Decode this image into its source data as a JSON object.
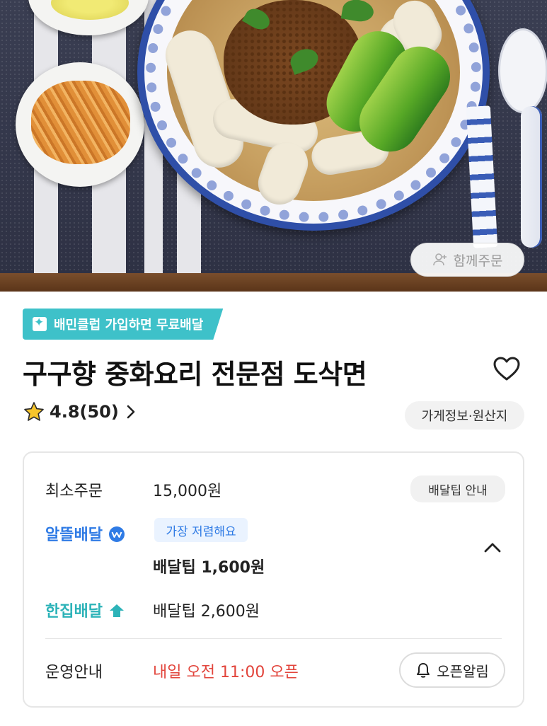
{
  "hero": {
    "together_order_label": "함께주문",
    "together_icon": "person-add-icon"
  },
  "promo": {
    "club_badge_label": "배민클럽 가입하면 무료배달",
    "club_icon": "baemin-club-icon"
  },
  "store": {
    "name": "구구향 중화요리 전문점 도삭면",
    "favorite_icon": "heart-outline-icon",
    "rating": "4.8(50)",
    "rating_icon": "star-icon",
    "info_button_label": "가게정보·원산지"
  },
  "delivery": {
    "min_order_label": "최소주문",
    "min_order_value": "15,000원",
    "tip_info_label": "배달팁 안내",
    "options": [
      {
        "name": "알뜰배달",
        "tag": "가장 저렴해요",
        "tip": "배달팁 1,600원",
        "color": "#2f7be5"
      },
      {
        "name": "한집배달",
        "tip": "배달팁 2,600원",
        "color": "#2db3b8"
      }
    ],
    "collapse_icon": "chevron-up-icon"
  },
  "hours": {
    "label": "운영안내",
    "status": "내일 오전 11:00 오픈",
    "status_color": "#e2453c",
    "alarm_button_label": "오픈알림",
    "alarm_icon": "bell-icon"
  },
  "colors": {
    "club_teal": "#3ec1c9",
    "brand_blue": "#2f7be5"
  }
}
